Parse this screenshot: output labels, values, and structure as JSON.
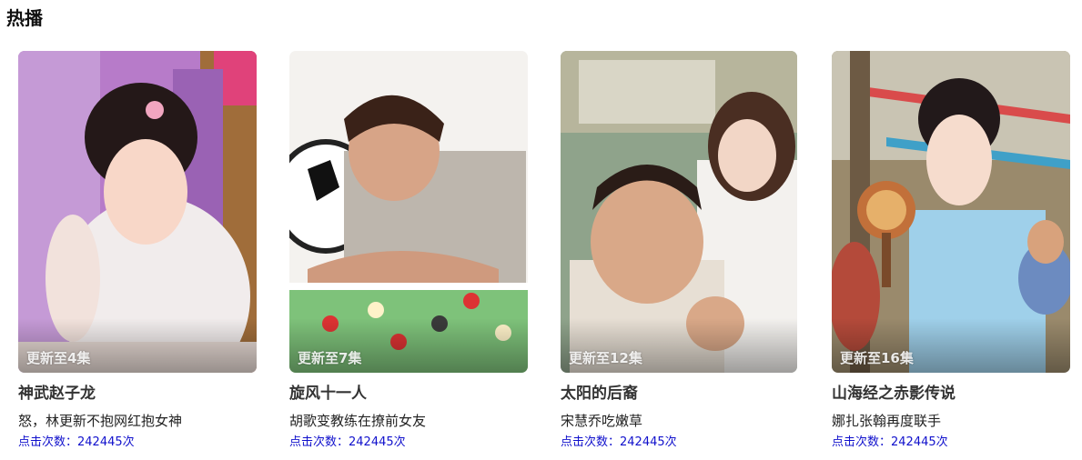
{
  "section": {
    "title": "热播"
  },
  "cards": [
    {
      "title": "神武赵子龙",
      "subtitle": "怒，林更新不抱网红抱女神",
      "episode_badge": "更新至4集",
      "clicks_label": "点击次数：242445次"
    },
    {
      "title": "旋风十一人",
      "subtitle": "胡歌变教练在撩前女友",
      "episode_badge": "更新至7集",
      "clicks_label": "点击次数：242445次"
    },
    {
      "title": "太阳的后裔",
      "subtitle": "宋慧乔吃嫩草",
      "episode_badge": "更新至12集",
      "clicks_label": "点击次数：242445次"
    },
    {
      "title": "山海经之赤影传说",
      "subtitle": "娜扎张翰再度联手",
      "episode_badge": "更新至16集",
      "clicks_label": "点击次数：242445次"
    }
  ]
}
